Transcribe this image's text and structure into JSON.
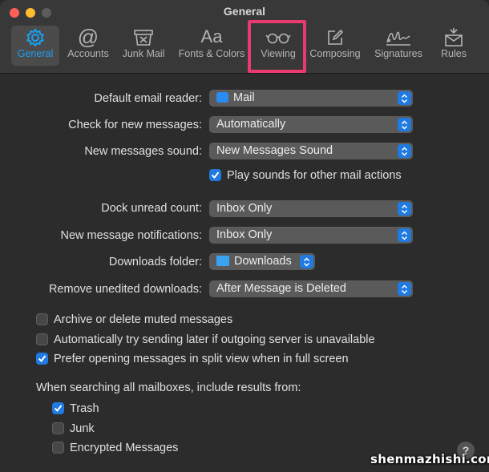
{
  "window": {
    "title": "General"
  },
  "tabs": [
    {
      "label": "General",
      "icon": "gear-icon",
      "active": true
    },
    {
      "label": "Accounts",
      "icon": "at-icon"
    },
    {
      "label": "Junk Mail",
      "icon": "junk-mail-icon"
    },
    {
      "label": "Fonts & Colors",
      "icon": "fonts-icon",
      "glyph": "Aa"
    },
    {
      "label": "Viewing",
      "icon": "glasses-icon"
    },
    {
      "label": "Composing",
      "icon": "compose-icon"
    },
    {
      "label": "Signatures",
      "icon": "signature-icon"
    },
    {
      "label": "Rules",
      "icon": "rules-icon"
    }
  ],
  "settings": {
    "default_reader": {
      "label": "Default email reader:",
      "value": "Mail"
    },
    "check_messages": {
      "label": "Check for new messages:",
      "value": "Automatically"
    },
    "new_sound": {
      "label": "New messages sound:",
      "value": "New Messages Sound"
    },
    "play_sounds": {
      "label": "Play sounds for other mail actions",
      "checked": true
    },
    "dock_count": {
      "label": "Dock unread count:",
      "value": "Inbox Only"
    },
    "notifications": {
      "label": "New message notifications:",
      "value": "Inbox Only"
    },
    "downloads_folder": {
      "label": "Downloads folder:",
      "value": "Downloads"
    },
    "remove_downloads": {
      "label": "Remove unedited downloads:",
      "value": "After Message is Deleted"
    }
  },
  "options": [
    {
      "label": "Archive or delete muted messages",
      "checked": false
    },
    {
      "label": "Automatically try sending later if outgoing server is unavailable",
      "checked": false
    },
    {
      "label": "Prefer opening messages in split view when in full screen",
      "checked": true
    }
  ],
  "search": {
    "label": "When searching all mailboxes, include results from:",
    "items": [
      {
        "label": "Trash",
        "checked": true
      },
      {
        "label": "Junk",
        "checked": false
      },
      {
        "label": "Encrypted Messages",
        "checked": false
      }
    ]
  },
  "help_label": "?",
  "watermark": "shenmazhishi.com",
  "colors": {
    "accent": "#1f7be2",
    "highlight": "#e83a6e",
    "active_tab": "#1aa1f4"
  }
}
